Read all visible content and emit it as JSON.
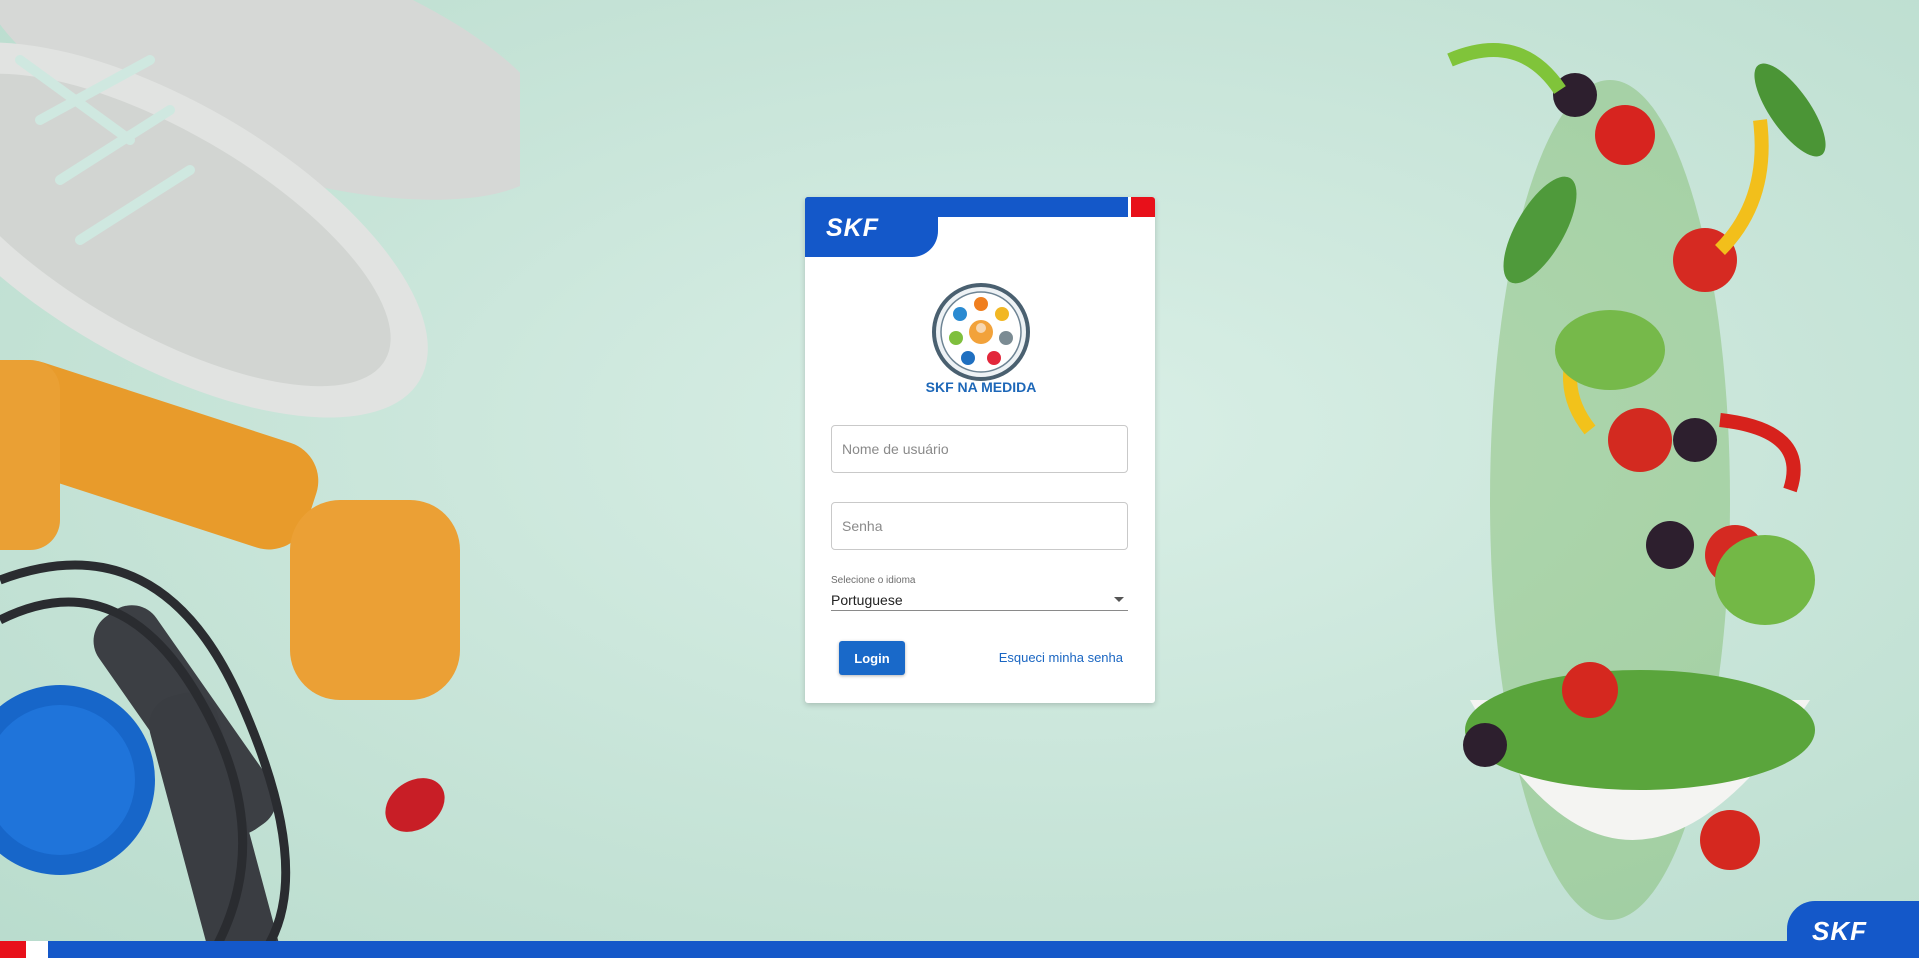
{
  "brand": {
    "logo_text": "SKF",
    "footer_logo_text": "SKF",
    "primary": "#1458c9",
    "accent_red": "#e8101a"
  },
  "emblem": {
    "text": "SKF NA MEDIDA"
  },
  "login_form": {
    "username_placeholder": "Nome de usuário",
    "password_placeholder": "Senha",
    "language_label": "Selecione o idioma",
    "language_value": "Portuguese",
    "login_label": "Login",
    "forgot_password": "Esqueci minha senha"
  }
}
